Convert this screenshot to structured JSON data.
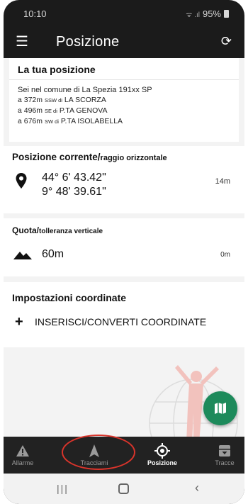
{
  "status_bar": {
    "time": "10:10",
    "signal": "ᯤ .ıl",
    "battery": "95%"
  },
  "app_bar": {
    "title": "Posizione"
  },
  "your_position": {
    "heading": "La tua posizione",
    "municipality_line": "Sei nel comune di La Spezia 191xx SP",
    "landmarks": [
      {
        "distance": "a 372m",
        "direction": "SSW di",
        "name": "LA SCORZA"
      },
      {
        "distance": "a 496m",
        "direction": "SE di",
        "name": "P.TA GENOVA"
      },
      {
        "distance": "a 676m",
        "direction": "SW di",
        "name": "P.TA ISOLABELLA"
      }
    ]
  },
  "current_position": {
    "title": "Posizione corrente/",
    "title_small": "raggio orizzontale",
    "latitude": "44° 6' 43.42\"",
    "longitude": "9° 48' 39.61\"",
    "radius": "14m"
  },
  "altitude": {
    "title": "Quota/",
    "title_small": "tolleranza verticale",
    "value": "60m",
    "tolerance": "0m"
  },
  "coordinates": {
    "title": "Impostazioni coordinate",
    "action": "INSERISCI/CONVERTI COORDINATE"
  },
  "bottom_nav": [
    {
      "label": "Allarme",
      "icon": "warning-icon"
    },
    {
      "label": "Tracciami",
      "icon": "navigation-arrow-icon"
    },
    {
      "label": "Posizione",
      "icon": "gps-target-icon",
      "active": true
    },
    {
      "label": "Tracce",
      "icon": "archive-icon"
    }
  ],
  "colors": {
    "app_bar": "#1b1b1b",
    "fab": "#1d8a5b",
    "highlight_circle": "#d9342b",
    "watermark": "#f2c2bd"
  }
}
